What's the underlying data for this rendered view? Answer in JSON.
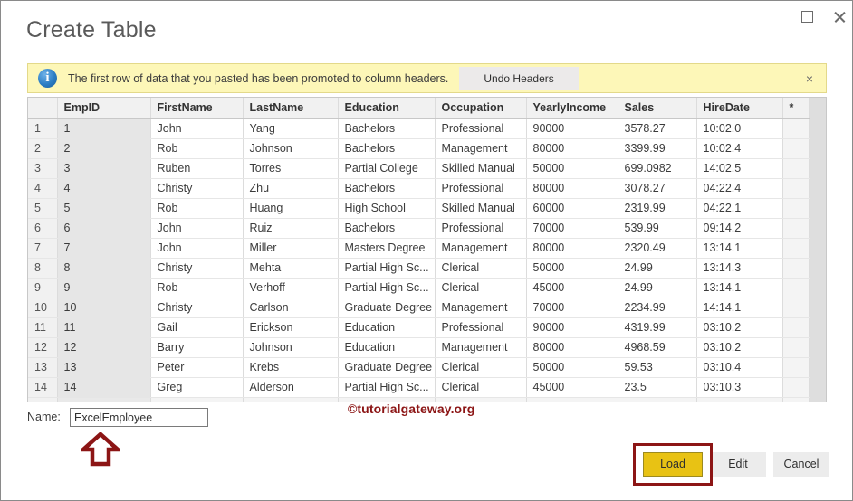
{
  "window": {
    "title": "Create Table",
    "controls": {
      "maximize": "maximize-icon",
      "close": "close-icon"
    }
  },
  "infobar": {
    "icon": "info-icon",
    "icon_glyph": "i",
    "message": "The first row of data that you pasted has been promoted to column headers.",
    "undo_label": "Undo Headers",
    "close_glyph": "×"
  },
  "grid": {
    "columns": [
      "",
      "EmpID",
      "FirstName",
      "LastName",
      "Education",
      "Occupation",
      "YearlyIncome",
      "Sales",
      "HireDate",
      "*"
    ],
    "rows": [
      {
        "n": "1",
        "EmpID": "1",
        "FirstName": "John",
        "LastName": "Yang",
        "Education": "Bachelors",
        "Occupation": "Professional",
        "YearlyIncome": "90000",
        "Sales": "3578.27",
        "HireDate": "10:02.0"
      },
      {
        "n": "2",
        "EmpID": "2",
        "FirstName": "Rob",
        "LastName": "Johnson",
        "Education": "Bachelors",
        "Occupation": "Management",
        "YearlyIncome": "80000",
        "Sales": "3399.99",
        "HireDate": "10:02.4"
      },
      {
        "n": "3",
        "EmpID": "3",
        "FirstName": "Ruben",
        "LastName": "Torres",
        "Education": "Partial College",
        "Occupation": "Skilled Manual",
        "YearlyIncome": "50000",
        "Sales": "699.0982",
        "HireDate": "14:02.5"
      },
      {
        "n": "4",
        "EmpID": "4",
        "FirstName": "Christy",
        "LastName": "Zhu",
        "Education": "Bachelors",
        "Occupation": "Professional",
        "YearlyIncome": "80000",
        "Sales": "3078.27",
        "HireDate": "04:22.4"
      },
      {
        "n": "5",
        "EmpID": "5",
        "FirstName": "Rob",
        "LastName": "Huang",
        "Education": "High School",
        "Occupation": "Skilled Manual",
        "YearlyIncome": "60000",
        "Sales": "2319.99",
        "HireDate": "04:22.1"
      },
      {
        "n": "6",
        "EmpID": "6",
        "FirstName": "John",
        "LastName": "Ruiz",
        "Education": "Bachelors",
        "Occupation": "Professional",
        "YearlyIncome": "70000",
        "Sales": "539.99",
        "HireDate": "09:14.2"
      },
      {
        "n": "7",
        "EmpID": "7",
        "FirstName": "John",
        "LastName": "Miller",
        "Education": "Masters Degree",
        "Occupation": "Management",
        "YearlyIncome": "80000",
        "Sales": "2320.49",
        "HireDate": "13:14.1"
      },
      {
        "n": "8",
        "EmpID": "8",
        "FirstName": "Christy",
        "LastName": "Mehta",
        "Education": "Partial High Sc...",
        "Occupation": "Clerical",
        "YearlyIncome": "50000",
        "Sales": "24.99",
        "HireDate": "13:14.3"
      },
      {
        "n": "9",
        "EmpID": "9",
        "FirstName": "Rob",
        "LastName": "Verhoff",
        "Education": "Partial High Sc...",
        "Occupation": "Clerical",
        "YearlyIncome": "45000",
        "Sales": "24.99",
        "HireDate": "13:14.1"
      },
      {
        "n": "10",
        "EmpID": "10",
        "FirstName": "Christy",
        "LastName": "Carlson",
        "Education": "Graduate Degree",
        "Occupation": "Management",
        "YearlyIncome": "70000",
        "Sales": "2234.99",
        "HireDate": "14:14.1"
      },
      {
        "n": "11",
        "EmpID": "11",
        "FirstName": "Gail",
        "LastName": "Erickson",
        "Education": "Education",
        "Occupation": "Professional",
        "YearlyIncome": "90000",
        "Sales": "4319.99",
        "HireDate": "03:10.2"
      },
      {
        "n": "12",
        "EmpID": "12",
        "FirstName": "Barry",
        "LastName": "Johnson",
        "Education": "Education",
        "Occupation": "Management",
        "YearlyIncome": "80000",
        "Sales": "4968.59",
        "HireDate": "03:10.2"
      },
      {
        "n": "13",
        "EmpID": "13",
        "FirstName": "Peter",
        "LastName": "Krebs",
        "Education": "Graduate Degree",
        "Occupation": "Clerical",
        "YearlyIncome": "50000",
        "Sales": "59.53",
        "HireDate": "03:10.4"
      },
      {
        "n": "14",
        "EmpID": "14",
        "FirstName": "Greg",
        "LastName": "Alderson",
        "Education": "Partial High Sc...",
        "Occupation": "Clerical",
        "YearlyIncome": "45000",
        "Sales": "23.5",
        "HireDate": "03:10.3"
      }
    ],
    "new_row_marker": "*"
  },
  "name_field": {
    "label": "Name:",
    "value": "ExcelEmployee"
  },
  "watermark": {
    "text": "©tutorialgateway.org"
  },
  "footer": {
    "load_label": "Load",
    "edit_label": "Edit",
    "cancel_label": "Cancel"
  },
  "colors": {
    "load_button": "#e8c214",
    "highlight": "#8c1515",
    "infobar_bg": "#fdf7b8",
    "title_text": "#5a5a5a"
  }
}
